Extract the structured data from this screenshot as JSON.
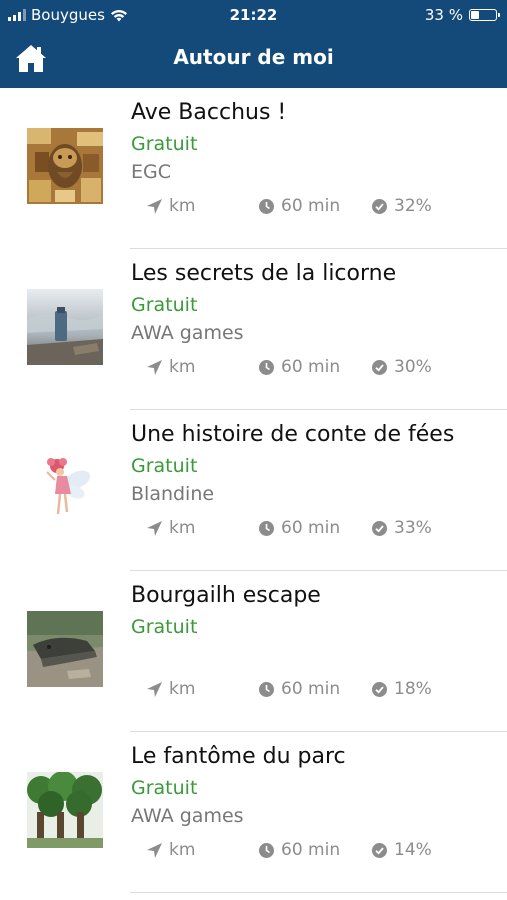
{
  "status_bar": {
    "carrier": "Bouygues",
    "time": "21:22",
    "battery_text": "33 %",
    "battery_level": 0.33
  },
  "header": {
    "title": "Autour de moi",
    "home_icon": "home-icon"
  },
  "colors": {
    "header_bg": "#134a79",
    "price_green": "#3a9a3a",
    "meta_gray": "#8c8c8c"
  },
  "items": [
    {
      "title": "Ave Bacchus !",
      "price": "Gratuit",
      "author": "EGC",
      "distance": "km",
      "duration": "60 min",
      "percent": "32%"
    },
    {
      "title": "Les secrets de la licorne",
      "price": "Gratuit",
      "author": "AWA games",
      "distance": "km",
      "duration": "60 min",
      "percent": "30%"
    },
    {
      "title": "Une histoire de conte de fées",
      "price": "Gratuit",
      "author": "Blandine",
      "distance": "km",
      "duration": "60 min",
      "percent": "33%"
    },
    {
      "title": "Bourgailh escape",
      "price": "Gratuit",
      "author": "",
      "distance": "km",
      "duration": "60 min",
      "percent": "18%"
    },
    {
      "title": "Le fantôme du parc",
      "price": "Gratuit",
      "author": "AWA games",
      "distance": "km",
      "duration": "60 min",
      "percent": "14%"
    }
  ]
}
